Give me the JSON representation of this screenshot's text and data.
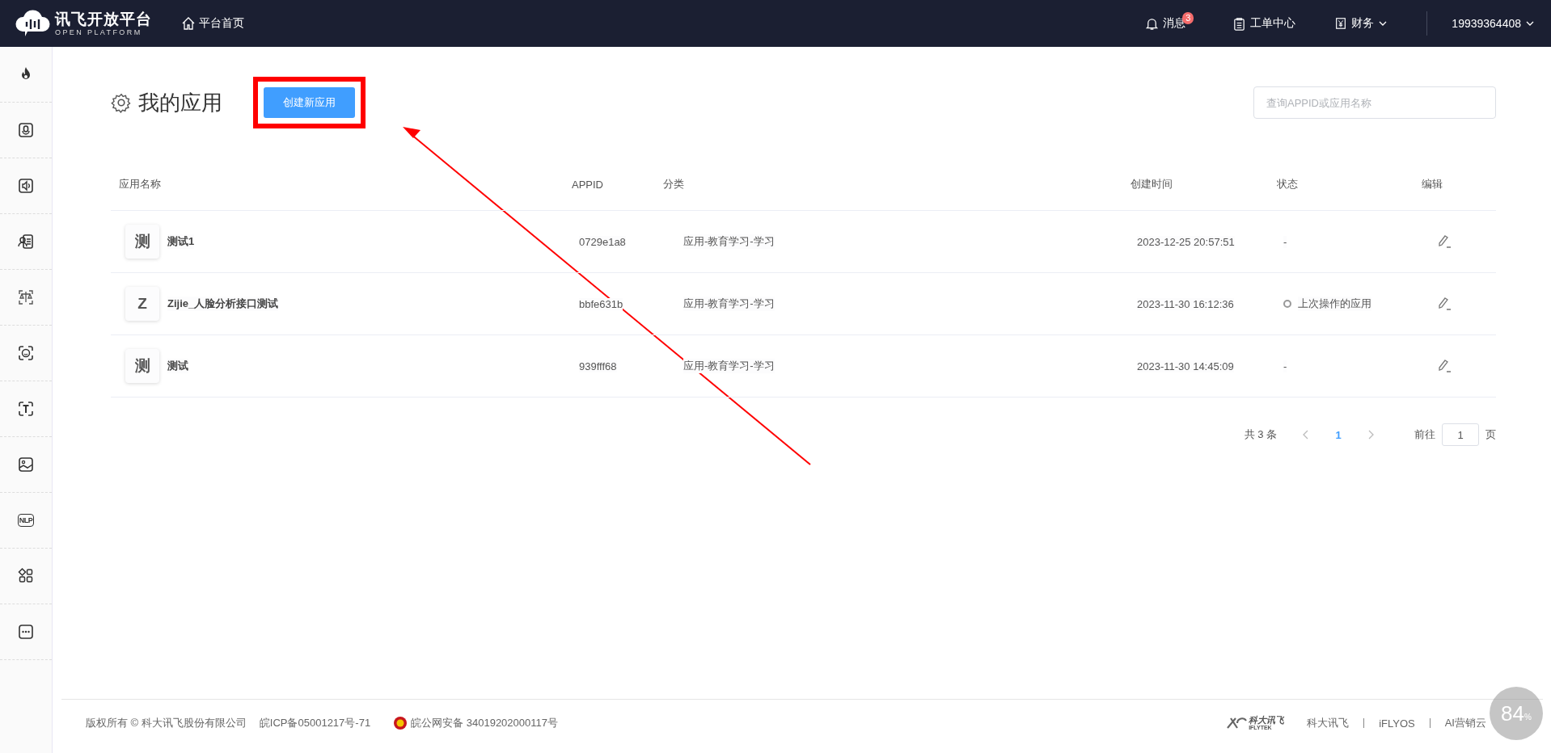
{
  "top_bar": {
    "logo_title": "讯飞开放平台",
    "logo_subtitle": "OPEN PLATFORM",
    "home_link": "平台首页",
    "messages": {
      "label": "消息",
      "badge": "3"
    },
    "tickets": "工单中心",
    "finance": "财务",
    "account": "19939364408"
  },
  "sidebar": {
    "nlp_label": "NLP"
  },
  "page": {
    "title": "我的应用",
    "create_button": "创建新应用",
    "search": {
      "placeholder": "查询APPID或应用名称"
    }
  },
  "table": {
    "columns": [
      "应用名称",
      "APPID",
      "分类",
      "创建时间",
      "状态",
      "编辑"
    ],
    "rows": [
      {
        "avatar": "测",
        "name": "测试1",
        "appid": "0729e1a8",
        "category": "应用-教育学习-学习",
        "created": "2023-12-25 20:57:51",
        "status": {
          "text": "-",
          "dot": false
        }
      },
      {
        "avatar": "Z",
        "name": "Zijie_人脸分析接口测试",
        "appid": "bbfe631b",
        "category": "应用-教育学习-学习",
        "created": "2023-11-30 16:12:36",
        "status": {
          "text": "上次操作的应用",
          "dot": true
        }
      },
      {
        "avatar": "测",
        "name": "测试",
        "appid": "939fff68",
        "category": "应用-教育学习-学习",
        "created": "2023-11-30 14:45:09",
        "status": {
          "text": "-",
          "dot": false
        }
      }
    ]
  },
  "pagination": {
    "total": "共 3 条",
    "pages": [
      {
        "label": "1",
        "selected": true
      }
    ],
    "goto_label": "前往",
    "goto_value": "1",
    "page_suffix": "页"
  },
  "footer": {
    "copyright": "版权所有 © 科大讯飞股份有限公司",
    "icp": "皖ICP备05001217号-71",
    "police": "皖公网安备 34019202000117号",
    "brand_cn": "科大讯飞",
    "brand_en": "IFLYTEK",
    "links": [
      "科大讯飞",
      "iFLYOS",
      "AI营销云"
    ]
  },
  "gauge": {
    "value": "84",
    "unit": "%"
  }
}
